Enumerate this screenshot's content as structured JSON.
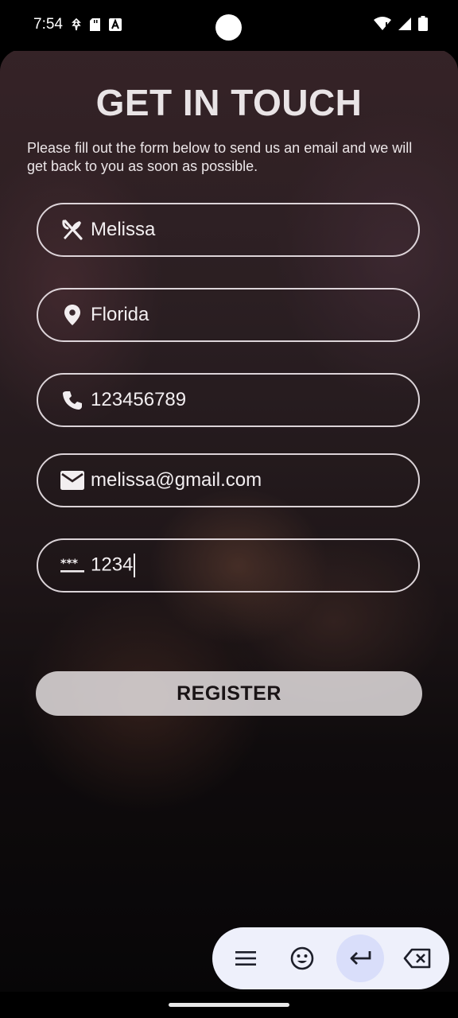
{
  "status_bar": {
    "time": "7:54"
  },
  "form": {
    "title": "GET IN TOUCH",
    "subtitle": "Please fill out the form below to send us an email and we will get back to you as soon as possible.",
    "name_value": "Melissa",
    "location_value": "Florida",
    "phone_value": "123456789",
    "email_value": "melissa@gmail.com",
    "password_value": "1234",
    "register_label": "REGISTER"
  },
  "icons": {
    "name": "restaurant-icon",
    "location": "location-pin-icon",
    "phone": "phone-icon",
    "email": "mail-icon",
    "password": "password-icon"
  },
  "colors": {
    "field_border": "#f0e8ec",
    "button_bg": "#ebe6e8",
    "keyboard_toolbar_bg": "#eef0fb",
    "keyboard_active_bg": "#d9defa"
  }
}
